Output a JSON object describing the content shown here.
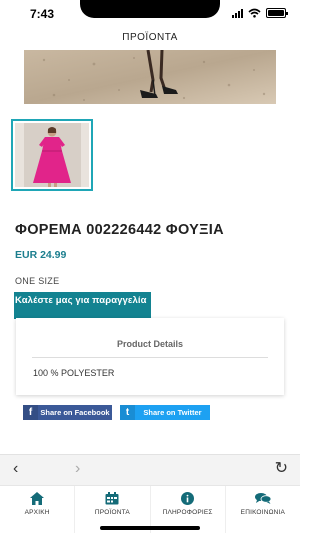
{
  "status_bar": {
    "time": "7:43"
  },
  "header": {
    "title": "ΠΡΟΪΟΝΤΑ"
  },
  "product": {
    "name": "ΦΟΡΕΜΑ 002226442 ΦΟΥΞΙΑ",
    "price": "EUR 24.99",
    "size": "ONE SIZE",
    "order_label": "Καλέστε μας για παραγγελία"
  },
  "details": {
    "title": "Product Details",
    "text": "100 % POLYESTER"
  },
  "share": {
    "facebook_label": "Share on Facebook",
    "facebook_icon": "f",
    "twitter_label": "Share on Twitter",
    "twitter_icon": "t"
  },
  "browser": {
    "back": "‹",
    "forward": "›",
    "reload": "↻"
  },
  "tabs": [
    {
      "label": "ΑΡΧΙΚΗ",
      "icon": "home-icon"
    },
    {
      "label": "ΠΡΟΪΟΝΤΑ",
      "icon": "products-icon"
    },
    {
      "label": "ΠΛΗΡΟΦΟΡΙΕΣ",
      "icon": "info-icon"
    },
    {
      "label": "ΕΠΙΚΟΙΝΩΝΙΑ",
      "icon": "contact-icon"
    }
  ],
  "colors": {
    "accent": "#138391",
    "price": "#1c7e8e",
    "thumb_border": "#1fa6b6",
    "tab_icon": "#146b78",
    "facebook": "#3b5998",
    "twitter": "#1da1f2"
  }
}
